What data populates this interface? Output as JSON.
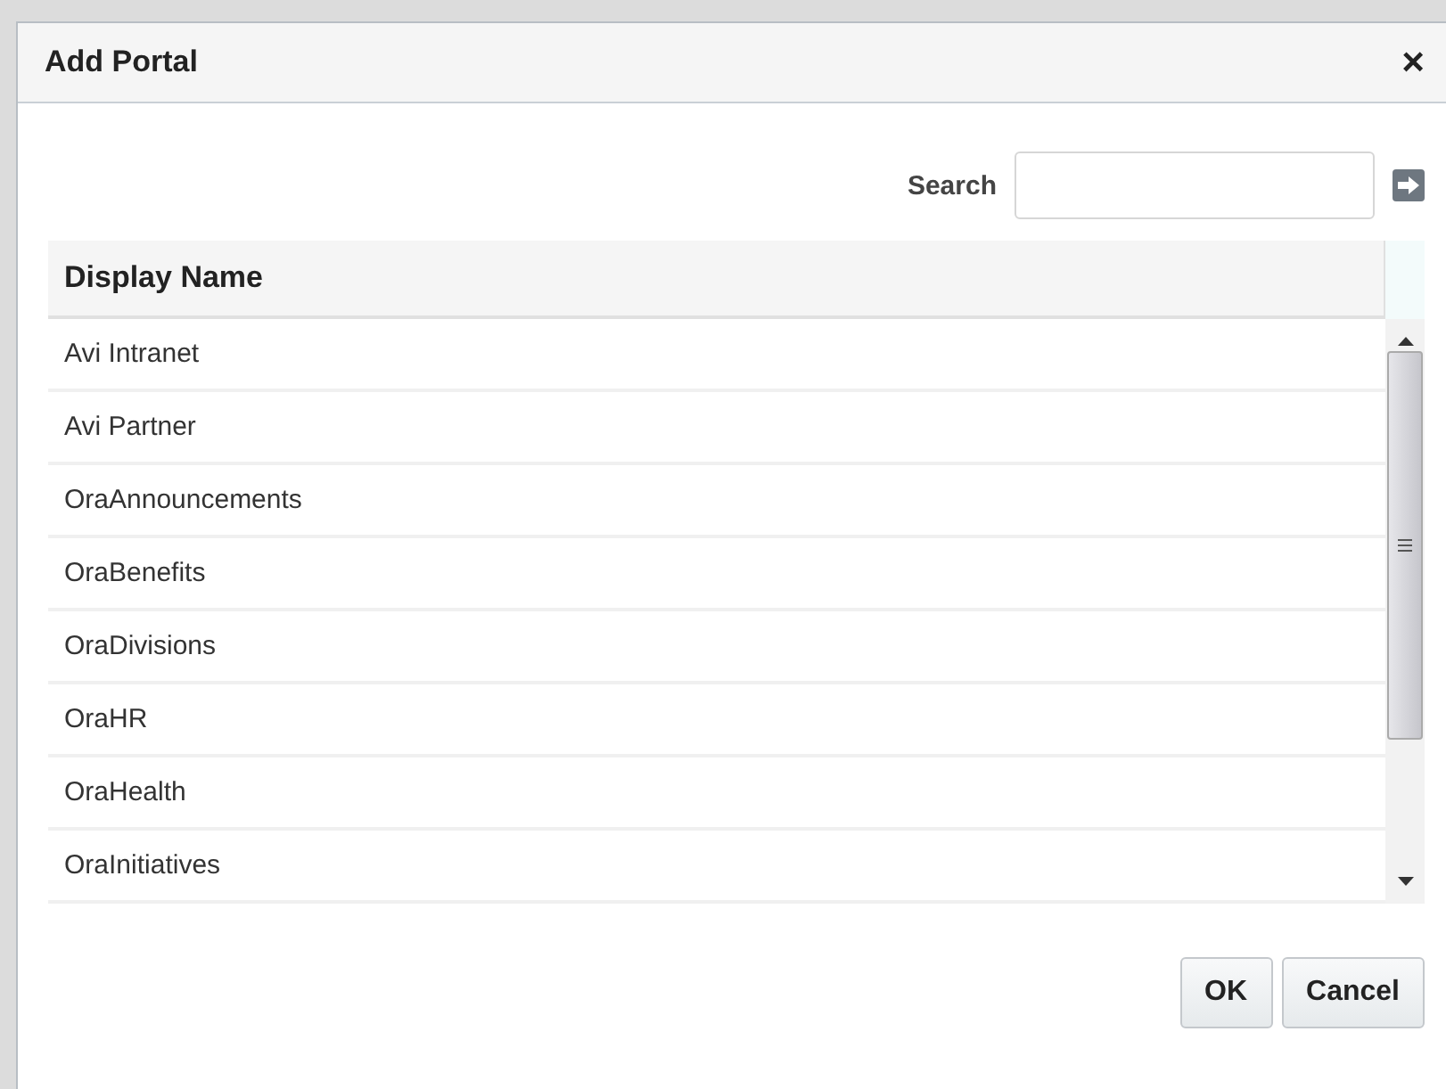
{
  "dialog": {
    "title": "Add Portal",
    "close": "×"
  },
  "search": {
    "label": "Search"
  },
  "table": {
    "columns": [
      "Display Name"
    ],
    "rows": [
      {
        "name": "Avi Intranet"
      },
      {
        "name": "Avi Partner"
      },
      {
        "name": "OraAnnouncements"
      },
      {
        "name": "OraBenefits"
      },
      {
        "name": "OraDivisions"
      },
      {
        "name": "OraHR"
      },
      {
        "name": "OraHealth"
      },
      {
        "name": "OraInitiatives"
      }
    ]
  },
  "buttons": [
    "OK",
    "Cancel"
  ]
}
